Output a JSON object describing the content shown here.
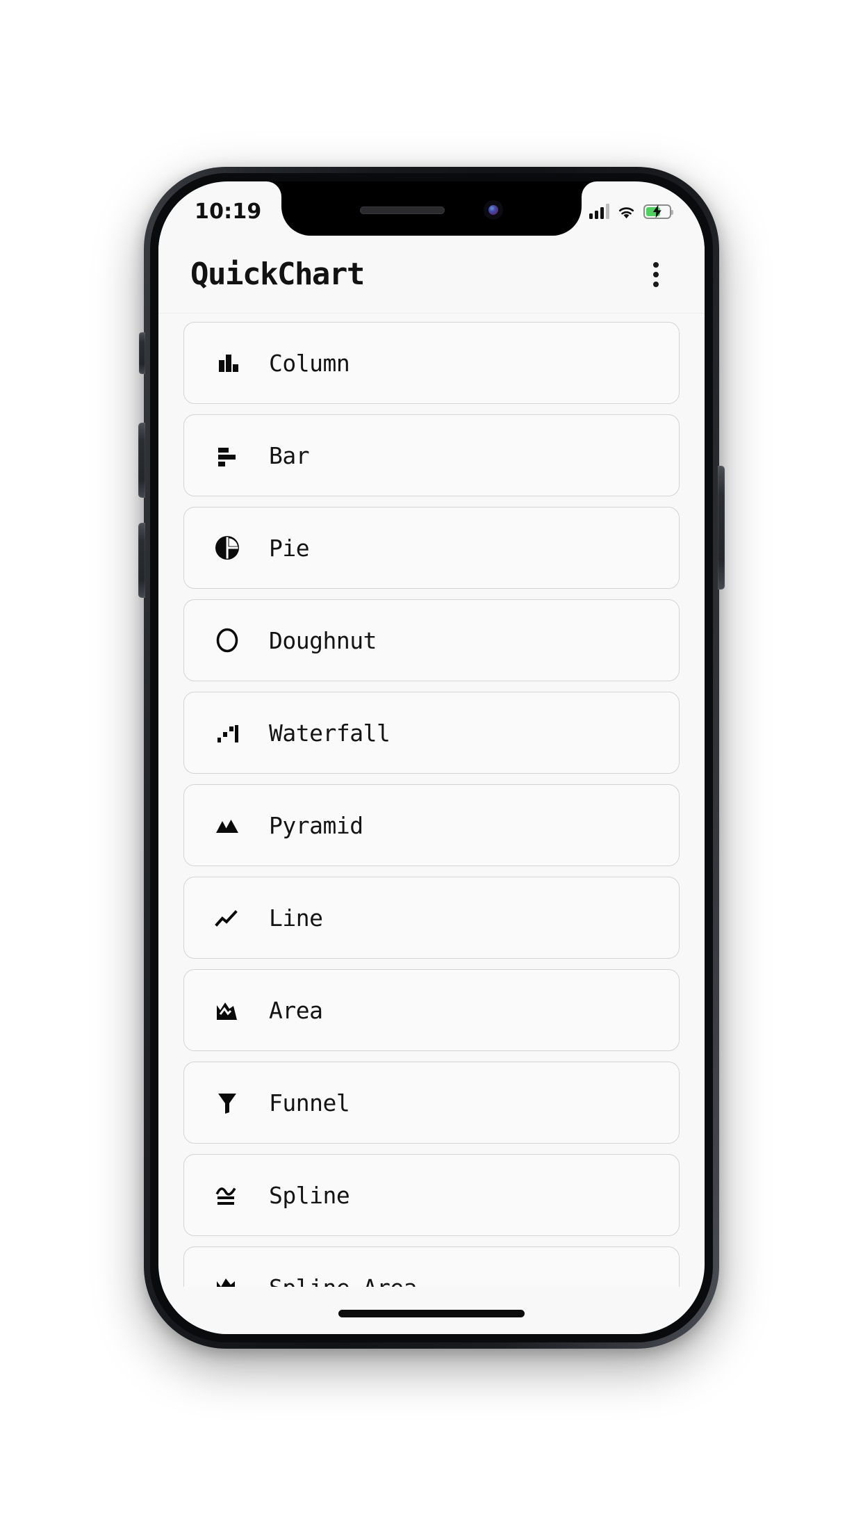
{
  "status_bar": {
    "time": "10:19",
    "signal_icon": "cellular-signal-icon",
    "signal_bars_filled": 3,
    "signal_bars_total": 4,
    "wifi_icon": "wifi-icon",
    "battery_icon": "battery-charging-icon",
    "battery_level_percent": 62,
    "battery_color": "#4ed25f",
    "charging": true
  },
  "app_bar": {
    "title": "QuickChart",
    "overflow_menu_icon": "more-vertical-icon"
  },
  "theme": {
    "screen_background": "#f8f8f8",
    "card_background": "#fafafa",
    "card_border": "#d4d4d4",
    "text_color": "#141414",
    "icon_color": "#0a0a0a"
  },
  "chart_list": [
    {
      "label": "Column",
      "icon": "column-chart-icon"
    },
    {
      "label": "Bar",
      "icon": "bar-chart-icon"
    },
    {
      "label": "Pie",
      "icon": "pie-chart-icon"
    },
    {
      "label": "Doughnut",
      "icon": "doughnut-chart-icon"
    },
    {
      "label": "Waterfall",
      "icon": "waterfall-chart-icon"
    },
    {
      "label": "Pyramid",
      "icon": "pyramid-chart-icon"
    },
    {
      "label": "Line",
      "icon": "line-chart-icon"
    },
    {
      "label": "Area",
      "icon": "area-chart-icon"
    },
    {
      "label": "Funnel",
      "icon": "funnel-chart-icon"
    },
    {
      "label": "Spline",
      "icon": "spline-chart-icon"
    },
    {
      "label": "Spline Area",
      "icon": "spline-area-chart-icon"
    }
  ]
}
